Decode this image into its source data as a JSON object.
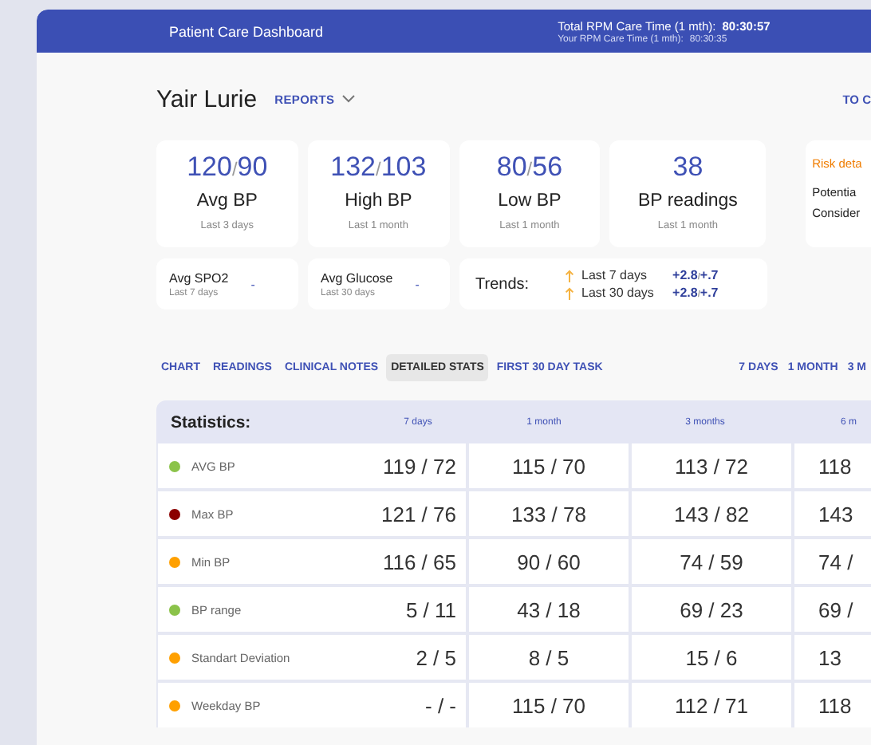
{
  "header": {
    "title": "Patient Care Dashboard",
    "total_label": "Total RPM Care Time (1 mth):",
    "total_value": "80:30:57",
    "your_label": "Your RPM Care Time (1 mth):",
    "your_value": "80:30:35"
  },
  "patient": {
    "name": "Yair Lurie",
    "menu": "REPORTS",
    "right_link": "TO C"
  },
  "cards": [
    {
      "sys": "120",
      "sep": "/",
      "dia": "90",
      "label": "Avg BP",
      "period": "Last 3 days"
    },
    {
      "sys": "132",
      "sep": "/",
      "dia": "103",
      "label": "High BP",
      "period": "Last 1 month"
    },
    {
      "sys": "80",
      "sep": "/",
      "dia": "56",
      "label": "Low BP",
      "period": "Last 1 month"
    },
    {
      "sys": "38",
      "label": "BP readings",
      "period": "Last 1 month"
    }
  ],
  "risk": {
    "title": "Risk deta",
    "lines": [
      "Potentia",
      "Consider"
    ]
  },
  "small_cards": [
    {
      "label": "Avg SPO2",
      "period": "Last 7 days",
      "value": "-"
    },
    {
      "label": "Avg Glucose",
      "period": "Last 30 days",
      "value": "-"
    }
  ],
  "trends": {
    "title": "Trends:",
    "rows": [
      {
        "label": "Last 7 days",
        "sys": "+2.8",
        "sep": "/",
        "dia": "+.7"
      },
      {
        "label": "Last 30 days",
        "sys": "+2.8",
        "sep": "/",
        "dia": "+.7"
      }
    ]
  },
  "tabs": [
    {
      "label": "CHART",
      "selected": false
    },
    {
      "label": "READINGS",
      "selected": false
    },
    {
      "label": "CLINICAL NOTES",
      "selected": false
    },
    {
      "label": "DETAILED STATS",
      "selected": true
    },
    {
      "label": "FIRST 30 DAY TASK",
      "selected": false
    }
  ],
  "ranges": [
    "7 DAYS",
    "1 MONTH",
    "3 M"
  ],
  "table": {
    "title": "Statistics:",
    "columns": [
      "7 days",
      "1 month",
      "3 months",
      "6 m"
    ],
    "rows": [
      {
        "label": "AVG BP",
        "color": "#8bc34a",
        "values": [
          "119 / 72",
          "115 / 70",
          "113 / 72",
          "118"
        ]
      },
      {
        "label": "Max BP",
        "color": "#8b0000",
        "values": [
          "121 / 76",
          "133 / 78",
          "143 / 82",
          "143"
        ]
      },
      {
        "label": "Min BP",
        "color": "#ffa000",
        "values": [
          "116 / 65",
          "90 / 60",
          "74 / 59",
          "74 /"
        ]
      },
      {
        "label": "BP range",
        "color": "#8bc34a",
        "values": [
          "5 / 11",
          "43 / 18",
          "69 / 23",
          "69 /"
        ]
      },
      {
        "label": "Standart Deviation",
        "color": "#ffa000",
        "values": [
          "2 / 5",
          "8 / 5",
          "15 / 6",
          "13"
        ]
      },
      {
        "label": "Weekday BP",
        "color": "#ffa000",
        "values": [
          "- / -",
          "115 / 70",
          "112 / 71",
          "118"
        ]
      }
    ]
  }
}
